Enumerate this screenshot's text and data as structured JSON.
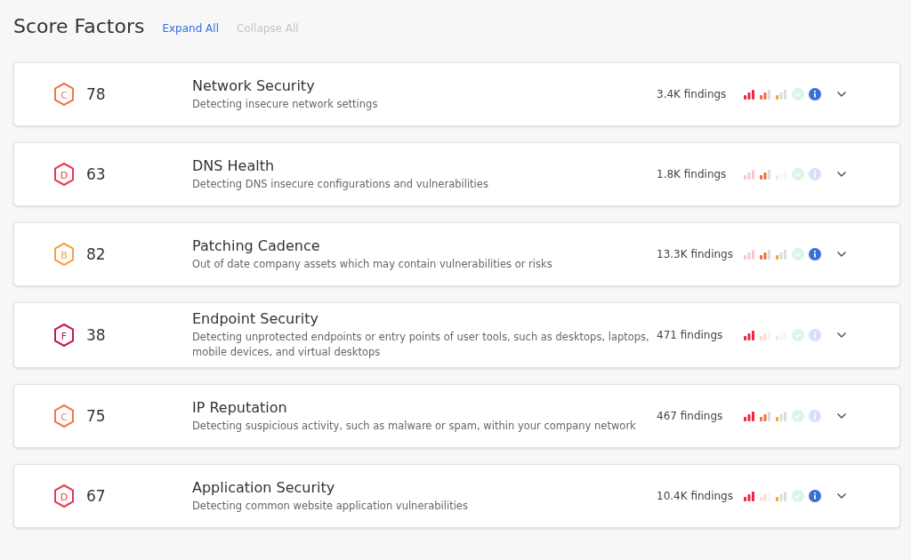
{
  "header": {
    "title": "Score Factors",
    "expand_all": {
      "label": "Expand All",
      "disabled": false
    },
    "collapse_all": {
      "label": "Collapse All",
      "disabled": true
    }
  },
  "factors": [
    {
      "grade": "C",
      "color": "#f7744a",
      "score": "78",
      "name": "Network Security",
      "description": "Detecting insecure network settings",
      "findings": "3.4K findings",
      "severities": {
        "critical": true,
        "high": true,
        "medium": true,
        "low": false,
        "info": true
      },
      "expanded": false
    },
    {
      "grade": "D",
      "color": "#e8394e",
      "score": "63",
      "name": "DNS Health",
      "description": "Detecting DNS insecure configurations and vulnerabilities",
      "findings": "1.8K findings",
      "severities": {
        "critical": false,
        "high": true,
        "medium": false,
        "low": false,
        "info": false
      },
      "expanded": false
    },
    {
      "grade": "B",
      "color": "#f5a33c",
      "score": "82",
      "name": "Patching Cadence",
      "description": "Out of date company assets which may contain vulnerabilities or risks",
      "findings": "13.3K findings",
      "severities": {
        "critical": false,
        "high": true,
        "medium": true,
        "low": false,
        "info": true
      },
      "expanded": false
    },
    {
      "grade": "F",
      "color": "#c8174a",
      "score": "38",
      "name": "Endpoint Security",
      "description": "Detecting unprotected endpoints or entry points of user tools, such as desktops, laptops, mobile devices, and virtual desktops",
      "findings": "471 findings",
      "severities": {
        "critical": true,
        "high": false,
        "medium": false,
        "low": false,
        "info": false
      },
      "expanded": false
    },
    {
      "grade": "C",
      "color": "#f7744a",
      "score": "75",
      "name": "IP Reputation",
      "description": "Detecting suspicious activity, such as malware or spam, within your company network",
      "findings": "467 findings",
      "severities": {
        "critical": true,
        "high": true,
        "medium": true,
        "low": false,
        "info": false
      },
      "expanded": false
    },
    {
      "grade": "D",
      "color": "#e8394e",
      "score": "67",
      "name": "Application Security",
      "description": "Detecting common website application vulnerabilities",
      "findings": "10.4K findings",
      "severities": {
        "critical": true,
        "high": false,
        "medium": true,
        "low": false,
        "info": true
      },
      "expanded": false
    }
  ]
}
